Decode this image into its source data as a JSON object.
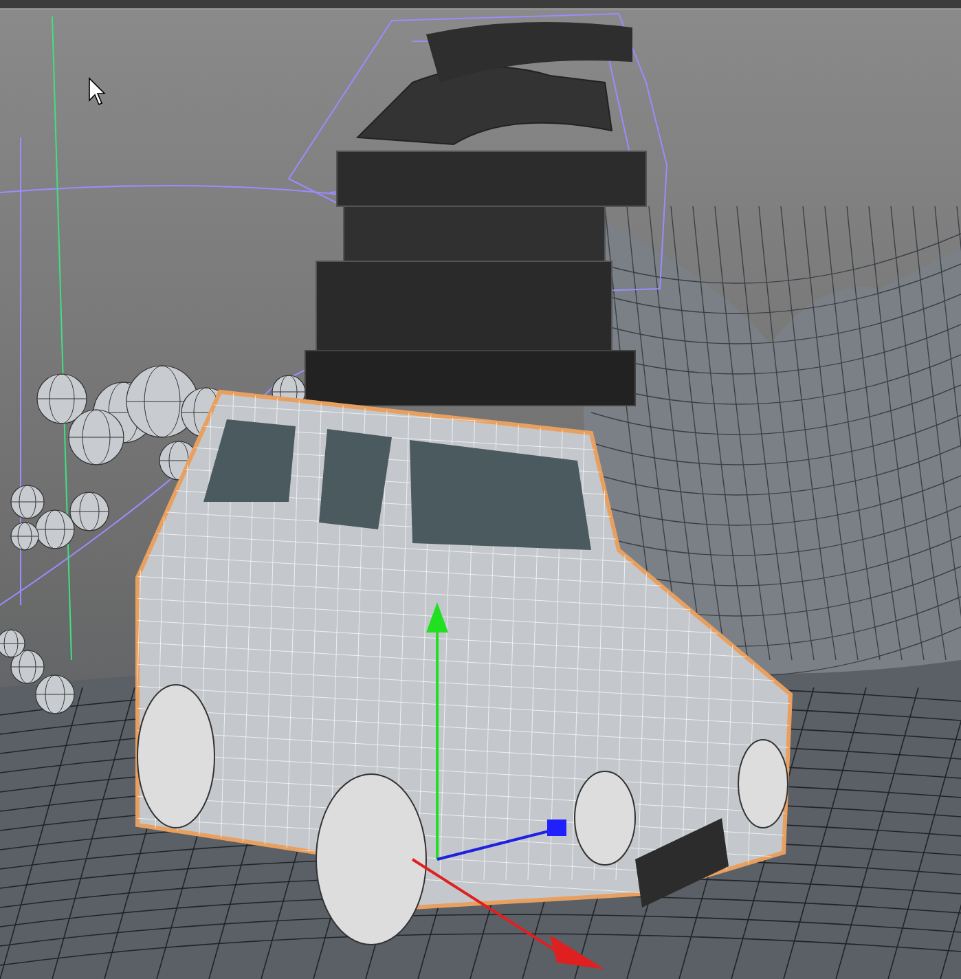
{
  "viewport": {
    "car_selected": true
  }
}
